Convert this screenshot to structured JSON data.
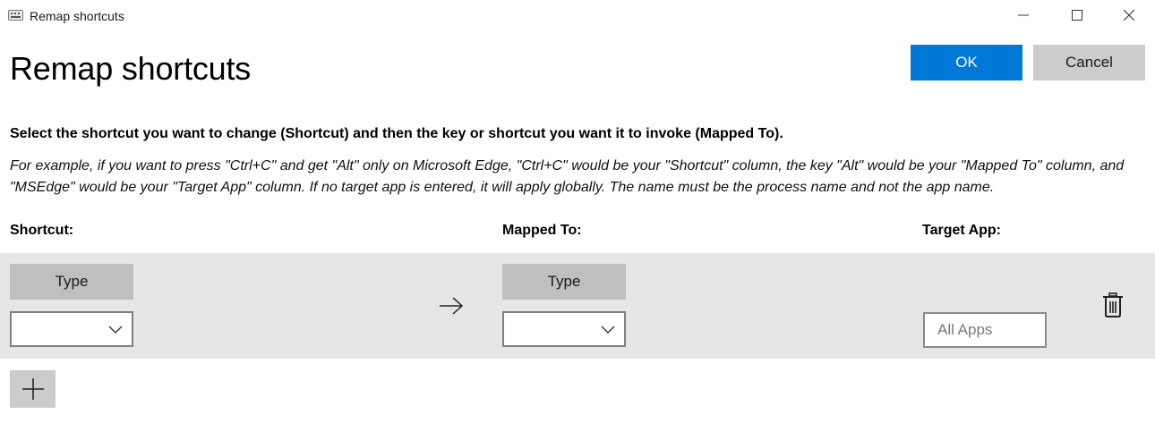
{
  "window": {
    "title": "Remap shortcuts",
    "icon": "keyboard-icon",
    "controls": [
      "minimize-icon",
      "maximize-icon",
      "close-icon"
    ]
  },
  "header": {
    "title": "Remap shortcuts",
    "ok_label": "OK",
    "cancel_label": "Cancel"
  },
  "instruction": "Select the shortcut you want to change (Shortcut) and then the key or shortcut you want it to invoke (Mapped To).",
  "example": "For example, if you want to press \"Ctrl+C\" and get \"Alt\" only on Microsoft Edge, \"Ctrl+C\" would be your \"Shortcut\" column, the key \"Alt\" would be your \"Mapped To\" column, and \"MSEdge\" would be your \"Target App\" column. If no target app is entered, it will apply globally. The name must be the process name and not the app name.",
  "columns": {
    "shortcut": "Shortcut:",
    "mapped_to": "Mapped To:",
    "target_app": "Target App:"
  },
  "row": {
    "shortcut_type_label": "Type",
    "shortcut_dropdown_value": "",
    "mapped_type_label": "Type",
    "mapped_dropdown_value": "",
    "target_app_placeholder": "All Apps",
    "target_app_value": "",
    "arrow_icon": "arrow-right-icon",
    "delete_icon": "trash-icon"
  },
  "add_icon": "plus-icon",
  "colors": {
    "accent": "#0078d7",
    "row_background": "#e6e6e6",
    "type_button": "#bfbfbf",
    "secondary_button": "#cccccc"
  }
}
